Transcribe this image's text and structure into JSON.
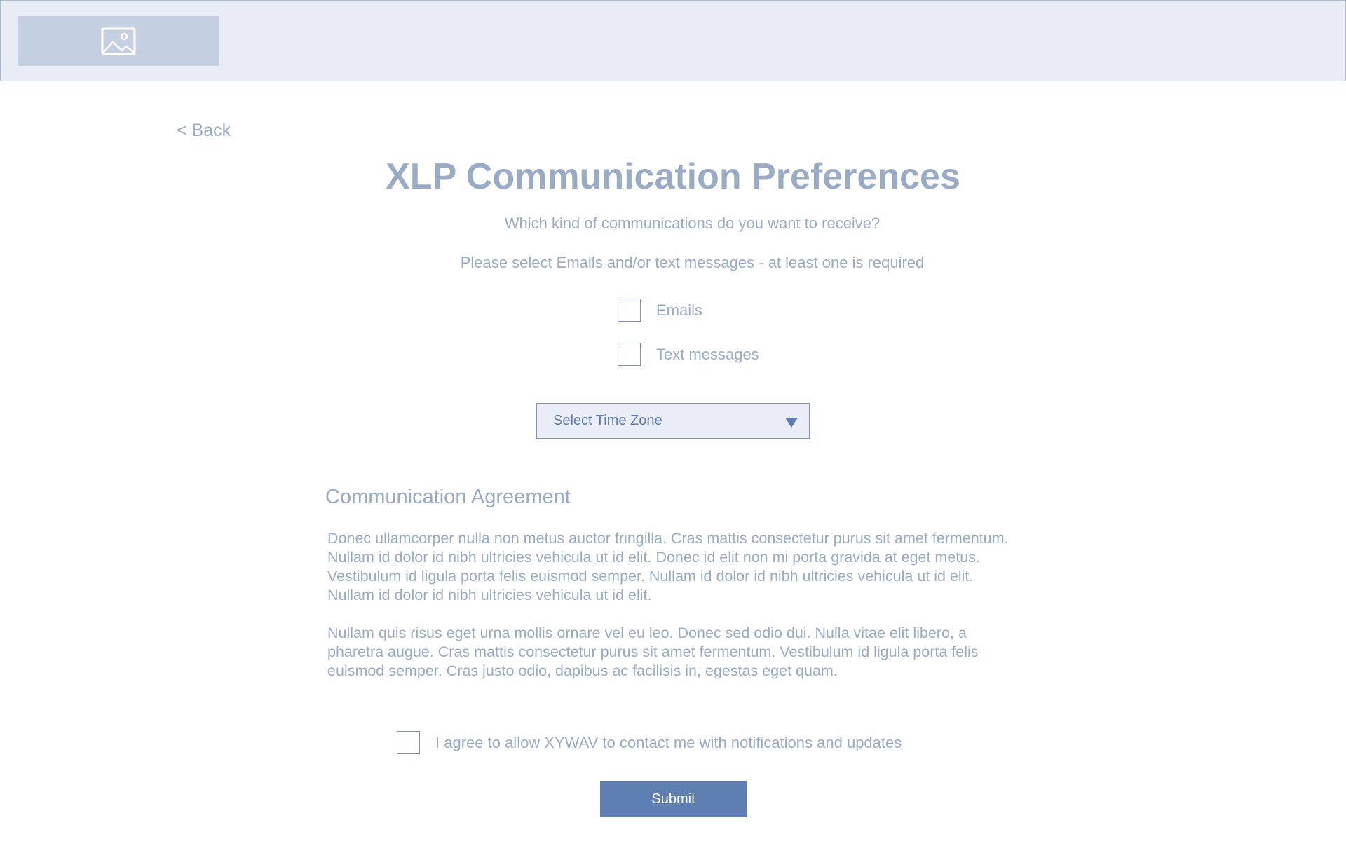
{
  "header": {
    "logo_icon": "image-placeholder-icon"
  },
  "nav": {
    "back_label": "< Back"
  },
  "main": {
    "title": "XLP Communication Preferences",
    "subtitle": "Which kind of communications do you want to receive?",
    "instruction": "Please select Emails and/or text messages - at least one is required",
    "options": [
      {
        "label": "Emails",
        "checked": false
      },
      {
        "label": "Text messages",
        "checked": false
      }
    ],
    "timezone": {
      "selected": "Select Time Zone"
    }
  },
  "agreement": {
    "title": "Communication Agreement",
    "paragraphs": [
      "Donec ullamcorper nulla non metus auctor fringilla. Cras mattis consectetur purus sit amet fermentum. Nullam id dolor id nibh ultricies vehicula ut id elit. Donec id elit non mi porta gravida at eget metus. Vestibulum id ligula porta felis euismod semper. Nullam id dolor id nibh ultricies vehicula ut id elit. Nullam id dolor id nibh ultricies vehicula ut id elit.",
      "Nullam quis risus eget urna mollis ornare vel eu leo. Donec sed odio dui. Nulla vitae elit libero, a pharetra augue. Cras mattis consectetur purus sit amet fermentum. Vestibulum id ligula porta felis euismod semper. Cras justo odio, dapibus ac facilisis in, egestas eget quam."
    ],
    "consent_label": "I agree to allow XYWAV to contact me with notifications and updates",
    "consent_checked": false
  },
  "actions": {
    "submit_label": "Submit"
  },
  "colors": {
    "header_bg": "#e9ecf5",
    "text_muted": "#9aabc6",
    "accent": "#5f7fb3"
  }
}
